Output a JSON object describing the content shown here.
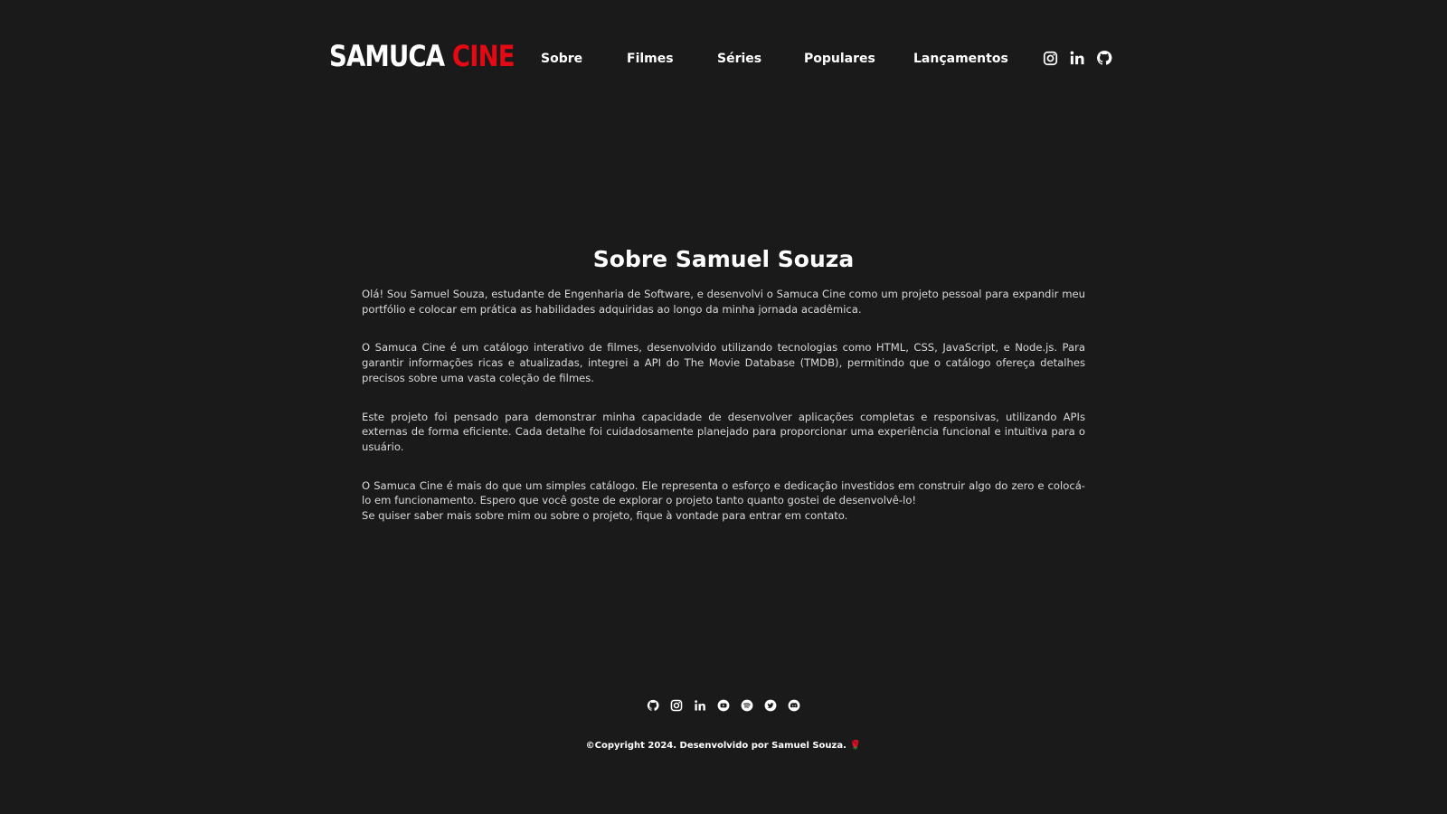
{
  "brand": {
    "logo_white": "SAMUCA",
    "logo_red": "CINE",
    "accent_color": "#e50914",
    "background_color": "#1a1a1a"
  },
  "nav": {
    "items": [
      {
        "label": "Sobre"
      },
      {
        "label": "Filmes"
      },
      {
        "label": "Séries"
      },
      {
        "label": "Populares"
      },
      {
        "label": "Lançamentos"
      }
    ]
  },
  "header_social": [
    "instagram-icon",
    "linkedin-icon",
    "github-icon"
  ],
  "main": {
    "title": "Sobre Samuel Souza",
    "paragraphs": [
      "Olá! Sou Samuel Souza, estudante de Engenharia de Software, e desenvolvi o Samuca Cine como um projeto pessoal para expandir meu portfólio e colocar em prática as habilidades adquiridas ao longo da minha jornada acadêmica.",
      "O Samuca Cine é um catálogo interativo de filmes, desenvolvido utilizando tecnologias como HTML, CSS, JavaScript, e Node.js. Para garantir informações ricas e atualizadas, integrei a API do The Movie Database (TMDB), permitindo que o catálogo ofereça detalhes precisos sobre uma vasta coleção de filmes.",
      "Este projeto foi pensado para demonstrar minha capacidade de desenvolver aplicações completas e responsivas, utilizando APIs externas de forma eficiente. Cada detalhe foi cuidadosamente planejado para proporcionar uma experiência funcional e intuitiva para o usuário.",
      "O Samuca Cine é mais do que um simples catálogo. Ele representa o esforço e dedicação investidos em construir algo do zero e colocá-lo em funcionamento. Espero que você goste de explorar o projeto tanto quanto gostei de desenvolvê-lo!",
      "Se quiser saber mais sobre mim ou sobre o projeto, fique à vontade para entrar em contato."
    ]
  },
  "footer": {
    "social": [
      "github-icon",
      "instagram-icon",
      "linkedin-icon",
      "youtube-icon",
      "spotify-icon",
      "twitter-icon",
      "discord-icon"
    ],
    "copyright": "©Copyright 2024. Desenvolvido por Samuel Souza.",
    "emoji": "🌹"
  }
}
